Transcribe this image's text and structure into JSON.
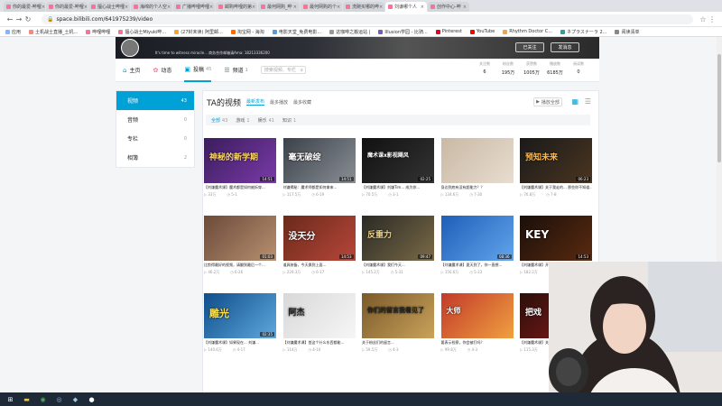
{
  "browser": {
    "tabs": [
      {
        "label": "你的最爱-哔哩"
      },
      {
        "label": "你的最爱-哔哩"
      },
      {
        "label": "擅心战士哔哩"
      },
      {
        "label": "海绵的个人空"
      },
      {
        "label": "广播哔哩哔哩"
      },
      {
        "label": "邮购哔哩的第"
      },
      {
        "label": "最何网购_哔"
      },
      {
        "label": "最何网购的个"
      },
      {
        "label": "洗碗买哪的哔"
      },
      {
        "label": "刘谦哪个人"
      },
      {
        "label": "创作中心-哔"
      }
    ],
    "url": "space.bilibili.com/641975239/video",
    "bookmarks": [
      "应用",
      "土机战士直播_土机...",
      "哔哩哔哩",
      "擅心战士Miyuki哔...",
      "(27封未读) 阿里邮...",
      "淘宝网 - 海淘",
      "电影天堂_免费电影...",
      "这咖啡之搬运站 |",
      "Illusion学园 - 比骑...",
      "Pinterest",
      "YouTube",
      "Rhythm Doctor C...",
      "ネプラスナーラ 2...",
      "阅读清单"
    ]
  },
  "profile": {
    "sign": "It's time to witness miracle... 商务合作邮箱请Ama: 18213336200",
    "follow_label": "已关注",
    "message_label": "发消息",
    "stats": [
      {
        "key": "关注数",
        "value": "6"
      },
      {
        "key": "粉丝数",
        "value": "195万"
      },
      {
        "key": "获赞数",
        "value": "1005万"
      },
      {
        "key": "播放数",
        "value": "6185万"
      },
      {
        "key": "阅读数",
        "value": "0"
      }
    ]
  },
  "nav": {
    "items": [
      {
        "label": "主页",
        "icon": "home-icon",
        "count": ""
      },
      {
        "label": "动态",
        "icon": "dynamic-icon",
        "count": ""
      },
      {
        "label": "投稿",
        "icon": "video-icon",
        "count": "45"
      },
      {
        "label": "频道",
        "icon": "channel-icon",
        "count": "1"
      }
    ],
    "search_placeholder": "搜索视频、专栏"
  },
  "leftmenu": [
    {
      "label": "视频",
      "count": "43"
    },
    {
      "label": "音频",
      "count": "0"
    },
    {
      "label": "专栏",
      "count": "0"
    },
    {
      "label": "相簿",
      "count": "2"
    }
  ],
  "videos": {
    "title": "TA的视频",
    "sorts": [
      "最新发布",
      "最多播放",
      "最多收藏"
    ],
    "play_all": "播放全部",
    "filters": [
      {
        "label": "全部",
        "count": "43"
      },
      {
        "label": "游戏",
        "count": "1"
      },
      {
        "label": "娱乐",
        "count": "41"
      },
      {
        "label": "知识",
        "count": "1"
      }
    ],
    "items": [
      {
        "title": "【刘谦魔术课】魔术都是如何被拆穿...",
        "views": "33万",
        "date": "5-1",
        "dur": "14:51",
        "overlay": "神秘的新学期"
      },
      {
        "title": "刘谦揭秘：魔术师都是如何拿来...",
        "views": "117.5万",
        "date": "6-19",
        "dur": "14:51",
        "overlay": "毫无破绽"
      },
      {
        "title": "【刘谦魔术课】刘谦Tim... 成为你...",
        "views": "70.5万",
        "date": "3-1",
        "dur": "02:25",
        "overlay": "魔术课x影视飓风"
      },
      {
        "title": "身边到底有没有超能力？？",
        "views": "134.6万",
        "date": "7-30",
        "dur": "",
        "overlay": ""
      },
      {
        "title": "【刘谦魔术课】关于我走的... 那些你不知道...",
        "views": "76.8万",
        "date": "7-8",
        "dur": "06:23",
        "overlay": "预知未来"
      },
      {
        "title": "比剪得最好的视频，请翻到最后一个...",
        "views": "46.2万",
        "date": "6-26",
        "dur": "01:03",
        "overlay": ""
      },
      {
        "title": "道具装备，今天换到上面...",
        "views": "229.3万",
        "date": "6-17",
        "dur": "14:53",
        "overlay": "没天分"
      },
      {
        "title": "【刘谦魔术课】我们今天...",
        "views": "145.2万",
        "date": "5-31",
        "dur": "09:47",
        "overlay": "反重力"
      },
      {
        "title": "【刘谦魔术课】夏天到了，你一直想...",
        "views": "156.6万",
        "date": "5-23",
        "dur": "08:36",
        "overlay": ""
      },
      {
        "title": "【刘谦魔术课】开车 KEY 一个爆款...",
        "views": "182.2万",
        "date": "5-7",
        "dur": "14:53",
        "overlay": "KEY"
      },
      {
        "title": "【刘谦魔术课】如果现在... 刘谦...",
        "views": "140.6万",
        "date": "4-17",
        "dur": "02:35",
        "overlay": "雕光"
      },
      {
        "title": "【刘谦魔术课】首这个什么东西都能...",
        "views": "114万",
        "date": "4-10",
        "dur": "",
        "overlay": "阿杰"
      },
      {
        "title": "关于粉丝们的留言...",
        "views": "59.5万",
        "date": "4-3",
        "dur": "",
        "overlay": "你们的留言我看见了"
      },
      {
        "title": "要表示检察，你会被打吗？",
        "views": "99.8万",
        "date": "4-3",
        "dur": "",
        "overlay": "大师"
      },
      {
        "title": "【刘谦魔术课】关于魔术... 也就是...",
        "views": "115.3万",
        "date": "3-6",
        "dur": "04:22",
        "overlay": "把戏"
      }
    ]
  }
}
